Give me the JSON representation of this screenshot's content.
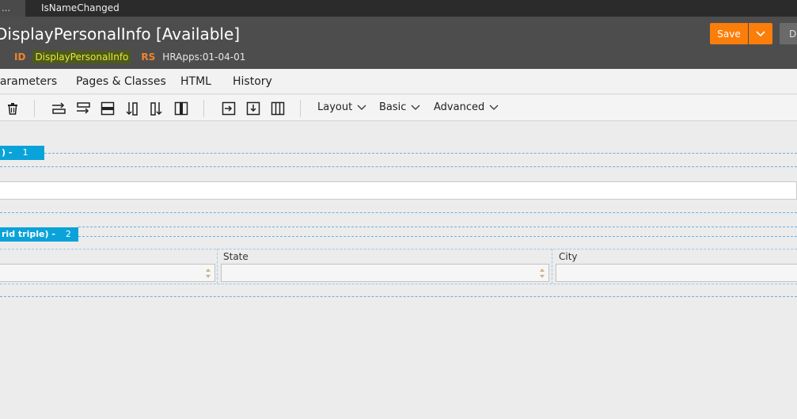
{
  "tabstrip": {
    "partial_tab": "…",
    "tab_label": "IsNameChanged"
  },
  "header": {
    "title": "DisplayPersonalInfo [Available]",
    "id_label": "ID",
    "id_value": "DisplayPersonalInfo",
    "rs_label": "RS",
    "rs_value": "HRApps:01-04-01",
    "save_label": "Save",
    "d_label": "D"
  },
  "navtabs": [
    "Parameters",
    "Pages & Classes",
    "HTML",
    "History"
  ],
  "toolbar": {
    "icons": [
      "trash-icon",
      "insert-row-before-icon",
      "insert-row-after-icon",
      "row-icon",
      "insert-column-before-icon",
      "insert-column-after-icon",
      "column-icon",
      "move-right-icon",
      "move-down-icon",
      "columns-icon"
    ],
    "menus": [
      "Layout",
      "Basic",
      "Advanced"
    ]
  },
  "canvas": {
    "layout1_label": ") -",
    "layout1_num": "1",
    "layout2_label": "rid triple) -",
    "layout2_num": "2",
    "field_state_label": "State",
    "field_city_label": "City"
  },
  "colors": {
    "accent_orange": "#fb7e0b",
    "badge_blue": "#0aa3d9",
    "header_bg": "#4d4d4d"
  }
}
